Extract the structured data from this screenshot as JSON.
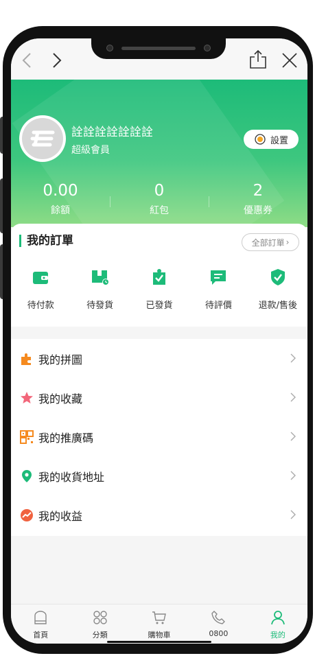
{
  "browser": {
    "back_icon": "chevron-left-icon",
    "forward_icon": "chevron-right-icon",
    "share_icon": "share-icon",
    "close_icon": "close-icon"
  },
  "profile": {
    "username": "詮詮詮詮詮詮詮",
    "level": "超級會員",
    "settings_label": "設置"
  },
  "stats": [
    {
      "value": "0.00",
      "label": "餘額"
    },
    {
      "value": "0",
      "label": "紅包"
    },
    {
      "value": "2",
      "label": "優惠券"
    }
  ],
  "orders": {
    "title": "我的訂單",
    "all_label": "全部訂單",
    "items": [
      {
        "label": "待付款",
        "icon": "wallet-icon"
      },
      {
        "label": "待發貨",
        "icon": "package-clock-icon"
      },
      {
        "label": "已發貨",
        "icon": "shipped-check-icon"
      },
      {
        "label": "待評價",
        "icon": "comment-icon"
      },
      {
        "label": "退款/售後",
        "icon": "shield-check-icon"
      }
    ]
  },
  "menu": [
    {
      "label": "我的拼圖",
      "icon": "puzzle-icon"
    },
    {
      "label": "我的收藏",
      "icon": "star-icon"
    },
    {
      "label": "我的推廣碼",
      "icon": "qr-code-icon"
    },
    {
      "label": "我的收貨地址",
      "icon": "location-pin-icon"
    },
    {
      "label": "我的收益",
      "icon": "earnings-icon"
    }
  ],
  "tabs": [
    {
      "label": "首頁",
      "icon": "home-icon"
    },
    {
      "label": "分類",
      "icon": "category-icon"
    },
    {
      "label": "購物車",
      "icon": "cart-icon"
    },
    {
      "label": "0800",
      "icon": "phone-icon"
    },
    {
      "label": "我的",
      "icon": "user-icon",
      "active": true
    }
  ],
  "colors": {
    "brand": "#1dbb79",
    "header_gradient_end": "#8fdc86"
  }
}
